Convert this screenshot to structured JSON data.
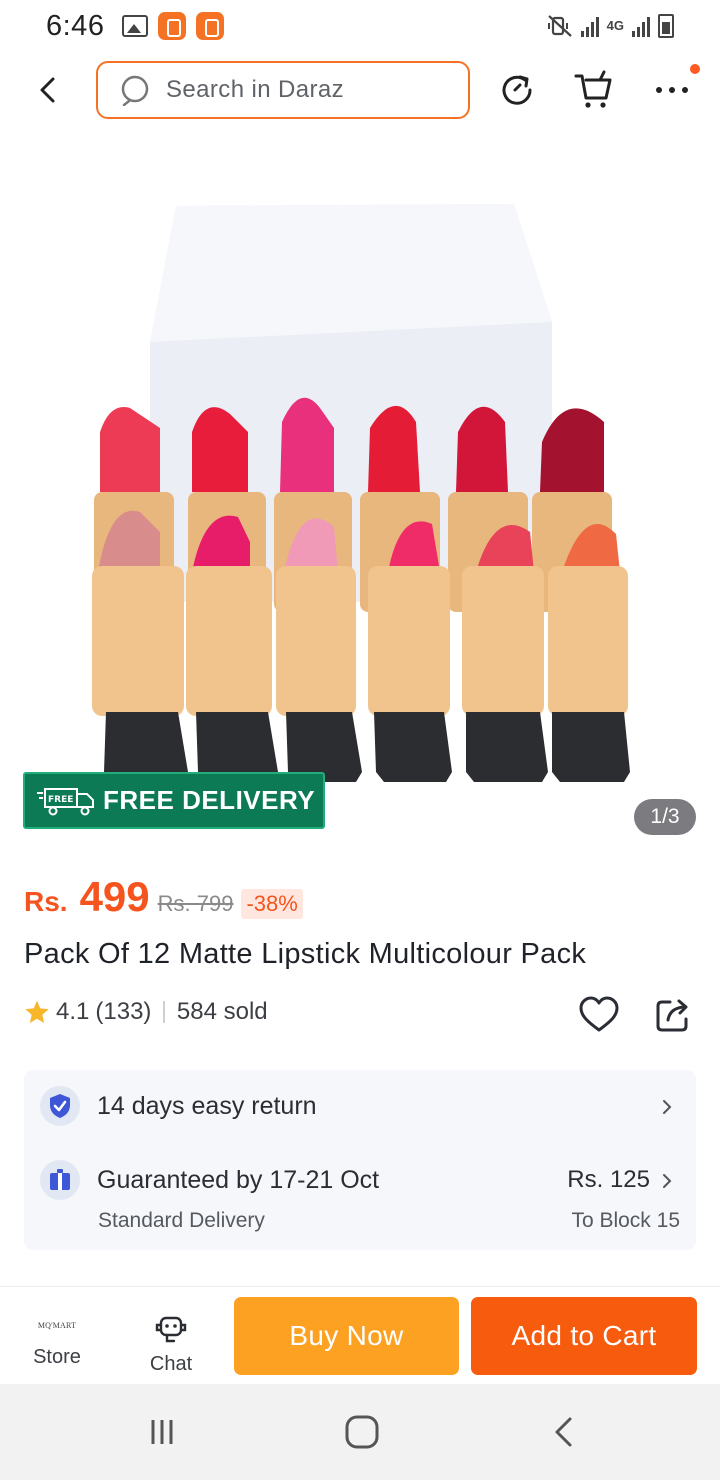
{
  "status_bar": {
    "time": "6:46",
    "network": "4G",
    "icons": [
      "gallery-icon",
      "daraz-app-icon",
      "daraz-app-icon",
      "mute-vibrate-icon",
      "signal-icon",
      "signal-icon",
      "battery-charging-icon"
    ]
  },
  "top_nav": {
    "search_placeholder": "Search in Daraz",
    "icons": [
      "back-icon",
      "search-icon",
      "history-icon",
      "cart-icon",
      "more-icon"
    ],
    "accent_color": "#f57224"
  },
  "gallery": {
    "badge": "FREE DELIVERY",
    "badge_truck_text": "FREE",
    "page_indicator": "1/3",
    "current_page": 1,
    "total_pages": 3
  },
  "product": {
    "currency": "Rs.",
    "price": "499",
    "old_price": "Rs. 799",
    "discount": "-38%",
    "title": "Pack Of 12 Matte Lipstick Multicolour Pack",
    "rating": "4.1",
    "rating_count": "(133)",
    "sold": "584 sold",
    "price_color": "#f5541e"
  },
  "delivery": {
    "return_policy": "14 days easy return",
    "guarantee": "Guaranteed by 17-21 Oct",
    "method": "Standard Delivery",
    "fee": "Rs. 125",
    "location": "To Block 15"
  },
  "actions": {
    "store_logo": "MQ'MART",
    "store_label": "Store",
    "chat_label": "Chat",
    "buy_now": "Buy Now",
    "add_to_cart": "Add to Cart",
    "buy_color": "#fca121",
    "cart_color": "#f75b0d"
  }
}
